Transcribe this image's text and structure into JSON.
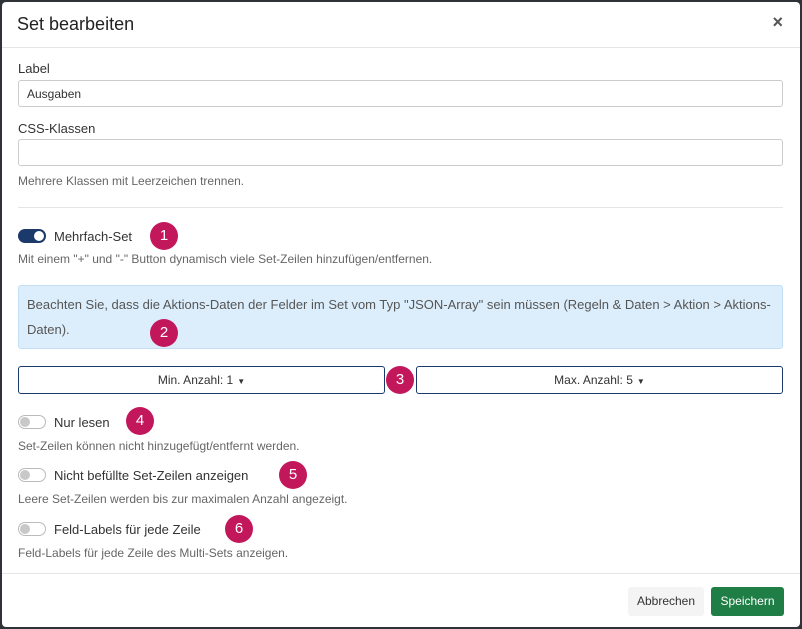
{
  "dialog": {
    "title": "Set bearbeiten",
    "close": "×"
  },
  "fields": {
    "label": {
      "label": "Label",
      "value": "Ausgaben"
    },
    "css": {
      "label": "CSS-Klassen",
      "value": "",
      "help": "Mehrere Klassen mit Leerzeichen trennen."
    }
  },
  "multi_set": {
    "label": "Mehrfach-Set",
    "enabled": true,
    "help": "Mit einem \"+\" und \"-\" Button dynamisch viele Set-Zeilen hinzufügen/entfernen.",
    "badge": "1"
  },
  "notice": {
    "text": "Beachten Sie, dass die Aktions-Daten der Felder im Set vom Typ \"JSON-Array\" sein müssen (Regeln & Daten > Aktion > Aktions-Daten).",
    "badge": "2"
  },
  "counts": {
    "min_label": "Min. Anzahl: 1",
    "max_label": "Max. Anzahl: 5",
    "badge": "3"
  },
  "read_only": {
    "label": "Nur lesen",
    "enabled": false,
    "help": "Set-Zeilen können nicht hinzugefügt/entfernt werden.",
    "badge": "4"
  },
  "show_empty": {
    "label": "Nicht befüllte Set-Zeilen anzeigen",
    "enabled": false,
    "help": "Leere Set-Zeilen werden bis zur maximalen Anzahl angezeigt.",
    "badge": "5"
  },
  "labels_each_row": {
    "label": "Feld-Labels für jede Zeile",
    "enabled": false,
    "help": "Feld-Labels für jede Zeile des Multi-Sets anzeigen.",
    "badge": "6"
  },
  "footer": {
    "cancel_label": "Abbrechen",
    "save_label": "Speichern"
  },
  "colors": {
    "accent": "#1b3a6b",
    "badge": "#c2185b",
    "save": "#1e7e45",
    "notice_bg": "#dceefc"
  }
}
